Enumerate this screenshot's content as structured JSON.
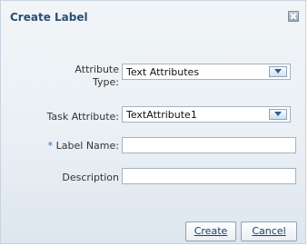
{
  "dialog": {
    "title": "Create Label",
    "close_icon": "close-icon"
  },
  "form": {
    "attribute_type": {
      "label_line1": "Attribute",
      "label_line2": "Type:",
      "selected": "Text Attributes"
    },
    "task_attribute": {
      "label": "Task Attribute:",
      "selected": "TextAttribute1"
    },
    "label_name": {
      "required_marker": "*",
      "label": "Label Name:",
      "value": ""
    },
    "description": {
      "label": "Description",
      "value": ""
    }
  },
  "buttons": {
    "create": "Create",
    "cancel": "Cancel"
  }
}
